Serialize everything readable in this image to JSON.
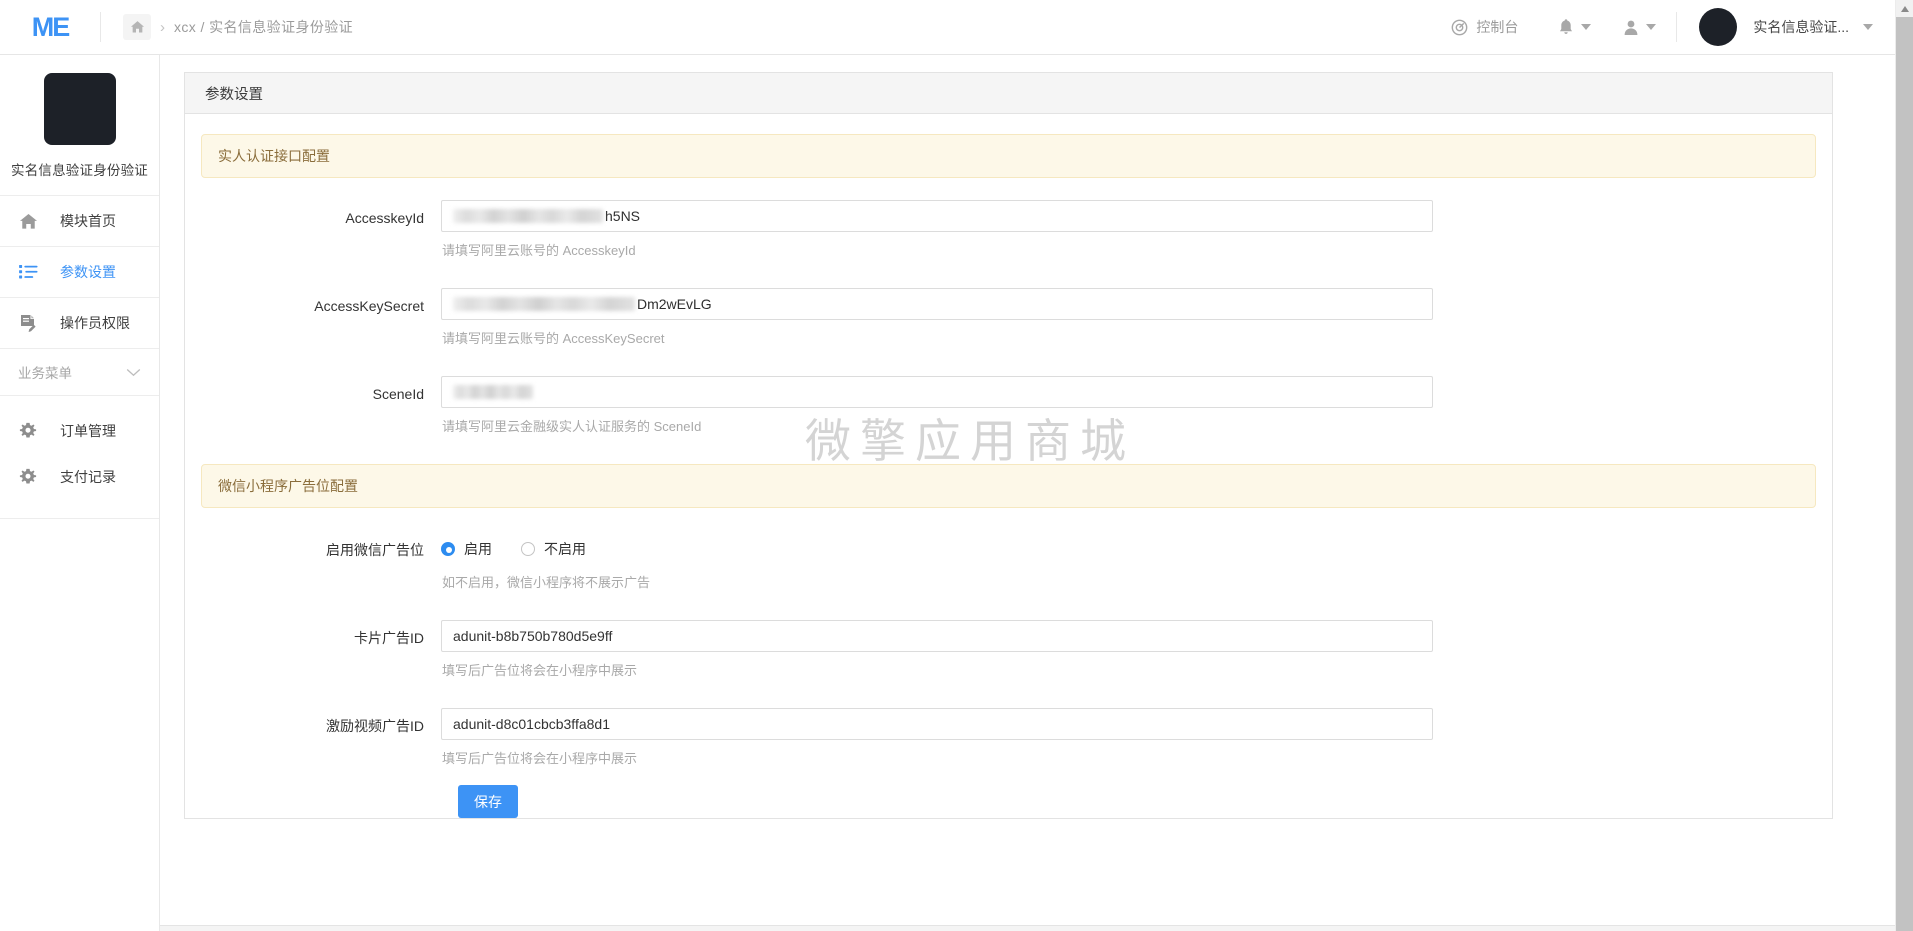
{
  "header": {
    "logo_text": "ME",
    "home_icon": "home-icon",
    "breadcrumb_separator": "›",
    "breadcrumb_text": "xcx / 实名信息验证身份验证",
    "console_label": "控制台",
    "console_icon": "target-icon",
    "bell_icon": "bell-icon",
    "user_icon": "user-icon",
    "account_name": "实名信息验证...",
    "caret_icon": "chevron-down-icon"
  },
  "sidebar": {
    "module_title": "实名信息验证身份验证",
    "items": [
      {
        "label": "模块首页",
        "icon": "home-icon",
        "active": false
      },
      {
        "label": "参数设置",
        "icon": "list-settings-icon",
        "active": true
      },
      {
        "label": "操作员权限",
        "icon": "document-edit-icon",
        "active": false
      }
    ],
    "group": {
      "label": "业务菜单",
      "icon": "chevron-down-icon"
    },
    "sub_items": [
      {
        "label": "订单管理",
        "icon": "gear-icon"
      },
      {
        "label": "支付记录",
        "icon": "gear-icon"
      }
    ]
  },
  "panel": {
    "title": "参数设置"
  },
  "sections": [
    {
      "alert": "实人认证接口配置",
      "fields": [
        {
          "label": "AccesskeyId",
          "value_redacted": true,
          "redact_width": 150,
          "value_tail": "h5NS",
          "help": "请填写阿里云账号的 AccesskeyId"
        },
        {
          "label": "AccessKeySecret",
          "value_redacted": true,
          "redact_width": 182,
          "value_tail": "Dm2wEvLG",
          "help": "请填写阿里云账号的 AccessKeySecret"
        },
        {
          "label": "SceneId",
          "value_redacted": true,
          "redact_width": 80,
          "value_tail": "",
          "help": "请填写阿里云金融级实人认证服务的 SceneId"
        }
      ]
    }
  ],
  "ad_section": {
    "alert": "微信小程序广告位配置",
    "radio_field": {
      "label": "启用微信广告位",
      "options": [
        {
          "label": "启用",
          "checked": true
        },
        {
          "label": "不启用",
          "checked": false
        }
      ],
      "help": "如不启用，微信小程序将不展示广告"
    },
    "fields": [
      {
        "label": "卡片广告ID",
        "value": "adunit-b8b750b780d5e9ff",
        "help": "填写后广告位将会在小程序中展示"
      },
      {
        "label": "激励视频广告ID",
        "value": "adunit-d8c01cbcb3ffa8d1",
        "help": "填写后广告位将会在小程序中展示"
      }
    ]
  },
  "actions": {
    "save_label": "保存"
  },
  "watermark": "微擎应用商城",
  "colors": {
    "accent": "#3d93f5",
    "radio_checked": "#2d8cf0",
    "alert_bg": "#fdf8e8",
    "alert_border": "#f6e8c0",
    "alert_text": "#8a6d3b",
    "panel_head_bg": "#f5f5f5",
    "avatar": "#1d2128"
  }
}
